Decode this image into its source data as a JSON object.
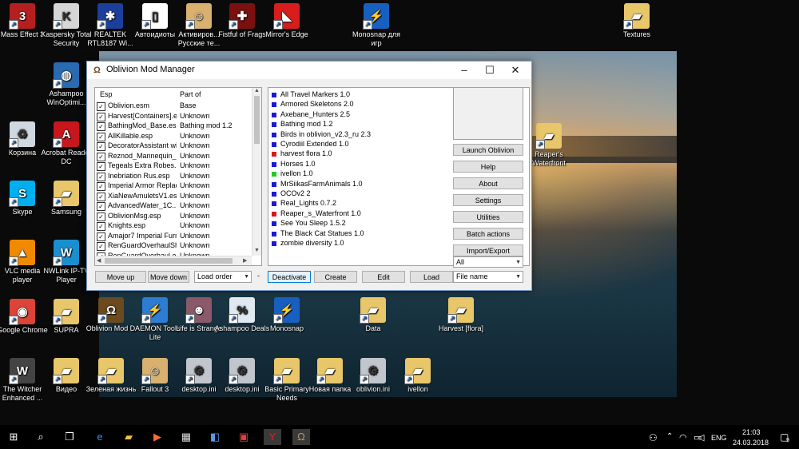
{
  "desktop": {
    "icons": [
      {
        "label": "Mass Effect 3",
        "color": "#b51f1f",
        "glyph": "3"
      },
      {
        "label": "Kaspersky Total Security",
        "color": "#d6d6d6",
        "glyph": "K"
      },
      {
        "label": "REALTEK RTL8187 Wi...",
        "color": "#1c3f9c",
        "glyph": "✱"
      },
      {
        "label": "Автоидиоты",
        "color": "#ffffff",
        "glyph": "▯"
      },
      {
        "label": "Активиров... Русские те...",
        "color": "#d8b070",
        "glyph": "☺"
      },
      {
        "label": "Fistful of Frags",
        "color": "#7a1010",
        "glyph": "✚"
      },
      {
        "label": "Mirror's Edge",
        "color": "#d81d1d",
        "glyph": "◣"
      },
      {
        "label": "Monosnap для игр",
        "color": "#1860c0",
        "glyph": "⚡"
      },
      {
        "label": "Textures",
        "color": "#e8c66a",
        "glyph": "▰"
      },
      {
        "label": "Ashampoo WinOptimi...",
        "color": "#2a6ab0",
        "glyph": "◍"
      },
      {
        "label": "Корзина",
        "color": "#cfd8e0",
        "glyph": "♻"
      },
      {
        "label": "Acrobat Reader DC",
        "color": "#c8161d",
        "glyph": "A"
      },
      {
        "label": "Skype",
        "color": "#00aff0",
        "glyph": "S"
      },
      {
        "label": "Samsung",
        "color": "#e8c66a",
        "glyph": "▰"
      },
      {
        "label": "VLC media player",
        "color": "#f08a00",
        "glyph": "▲"
      },
      {
        "label": "NWLink IP-TV Player",
        "color": "#1a8fd0",
        "glyph": "W"
      },
      {
        "label": "Google Chrome",
        "color": "#db4437",
        "glyph": "◉"
      },
      {
        "label": "SUPRA",
        "color": "#e8c66a",
        "glyph": "▰"
      },
      {
        "label": "Oblivion Mod ...",
        "color": "#6b4a1f",
        "glyph": "Ω"
      },
      {
        "label": "DAEMON Tools Lite",
        "color": "#2d7dd2",
        "glyph": "⚡"
      },
      {
        "label": "Life is Strange",
        "color": "#8a5a6a",
        "glyph": "☻"
      },
      {
        "label": "Ashampoo Deals",
        "color": "#e0e8f0",
        "glyph": "%"
      },
      {
        "label": "Monosnap",
        "color": "#1860c0",
        "glyph": "⚡"
      },
      {
        "label": "Data",
        "color": "#e8c66a",
        "glyph": "▰"
      },
      {
        "label": "Harvest [flora]",
        "color": "#e8c66a",
        "glyph": "▰"
      },
      {
        "label": "The Witcher Enhanced ...",
        "color": "#444444",
        "glyph": "W"
      },
      {
        "label": "Видео",
        "color": "#e8c66a",
        "glyph": "▰"
      },
      {
        "label": "Зеленая жизнь",
        "color": "#e8c66a",
        "glyph": "▰"
      },
      {
        "label": "Fallout 3",
        "color": "#d8b070",
        "glyph": "☺"
      },
      {
        "label": "desktop.ini",
        "color": "#c0c6cc",
        "glyph": "⚙"
      },
      {
        "label": "desktop.ini",
        "color": "#c0c6cc",
        "glyph": "⚙"
      },
      {
        "label": "Basic Primary Needs",
        "color": "#e8c66a",
        "glyph": "▰"
      },
      {
        "label": "Новая папка",
        "color": "#e8c66a",
        "glyph": "▰"
      },
      {
        "label": "oblivion.ini",
        "color": "#c0c6cc",
        "glyph": "⚙"
      },
      {
        "label": "ivellon",
        "color": "#e8c66a",
        "glyph": "▰"
      },
      {
        "label": "Reaper's Waterfront",
        "color": "#e8c66a",
        "glyph": "▰"
      }
    ]
  },
  "window": {
    "title": "Oblivion Mod Manager",
    "esp_headers": {
      "esp": "Esp",
      "part_of": "Part of"
    },
    "esp_list": [
      {
        "name": "Oblivion.esm",
        "part": "Base"
      },
      {
        "name": "Harvest[Containers].e...",
        "part": "Unknown"
      },
      {
        "name": "BathingMod_Base.esm",
        "part": "Bathing mod 1.2"
      },
      {
        "name": "AllKillable.esp",
        "part": "Unknown"
      },
      {
        "name": "DecoratorAssistant wit...",
        "part": "Unknown"
      },
      {
        "name": "Reznod_Mannequin_...",
        "part": "Unknown"
      },
      {
        "name": "Tegeals Extra Robes...",
        "part": "Unknown"
      },
      {
        "name": "Inebriation Rus.esp",
        "part": "Unknown"
      },
      {
        "name": "Imperial Armor Replac...",
        "part": "Unknown"
      },
      {
        "name": "XiaNewAmuletsV1.esp",
        "part": "Unknown"
      },
      {
        "name": "AdvancedWater_1C...",
        "part": "Unknown"
      },
      {
        "name": "OblivionMsg.esp",
        "part": "Unknown"
      },
      {
        "name": "Knights.esp",
        "part": "Unknown"
      },
      {
        "name": "Amajor7 Imperial Furni...",
        "part": "Unknown"
      },
      {
        "name": "RenGuardOverhaulSh...",
        "part": "Unknown"
      },
      {
        "name": "RenGuardOverhaul.esp",
        "part": "Unknown"
      }
    ],
    "mods": [
      {
        "name": "All Travel Markers 1.0",
        "color": "#1a1ad6"
      },
      {
        "name": "Armored Skeletons 2.0",
        "color": "#1a1ad6"
      },
      {
        "name": "Axebane_Hunters 2.5",
        "color": "#1a1ad6"
      },
      {
        "name": "Bathing mod 1.2",
        "color": "#1a1ad6"
      },
      {
        "name": "Birds in oblivion_v2.3_ru 2.3",
        "color": "#1a1ad6"
      },
      {
        "name": "Cyrodiil Extended 1.0",
        "color": "#1a1ad6"
      },
      {
        "name": "harvest flora 1.0",
        "color": "#d61a1a"
      },
      {
        "name": "Horses 1.0",
        "color": "#1a1ad6"
      },
      {
        "name": "ivellon 1.0",
        "color": "#22cc22"
      },
      {
        "name": "MrSiikasFarmAnimals 1.0",
        "color": "#1a1ad6"
      },
      {
        "name": "OCOv2 2",
        "color": "#1a1ad6"
      },
      {
        "name": "Real_Lights 0.7.2",
        "color": "#1a1ad6"
      },
      {
        "name": "Reaper_s_Waterfront 1.0",
        "color": "#d61a1a"
      },
      {
        "name": "See You Sleep 1.5.2",
        "color": "#1a1ad6"
      },
      {
        "name": "The Black Cat Statues 1.0",
        "color": "#1a1ad6"
      },
      {
        "name": "zombie diversity 1.0",
        "color": "#1a1ad6"
      }
    ],
    "side_buttons": [
      "Launch Oblivion",
      "Help",
      "About",
      "Settings",
      "Utilities",
      "Batch actions",
      "Import/Export"
    ],
    "filter_combo": "All",
    "sort_combo": "File name",
    "bottom": {
      "move_up": "Move up",
      "move_down": "Move down",
      "load_order": "Load order",
      "sep": "-",
      "deactivate": "Deactivate",
      "create": "Create",
      "edit": "Edit",
      "load": "Load"
    }
  },
  "taskbar": {
    "lang": "ENG",
    "time": "21:03",
    "date": "24.03.2018",
    "notif_count": "9"
  }
}
